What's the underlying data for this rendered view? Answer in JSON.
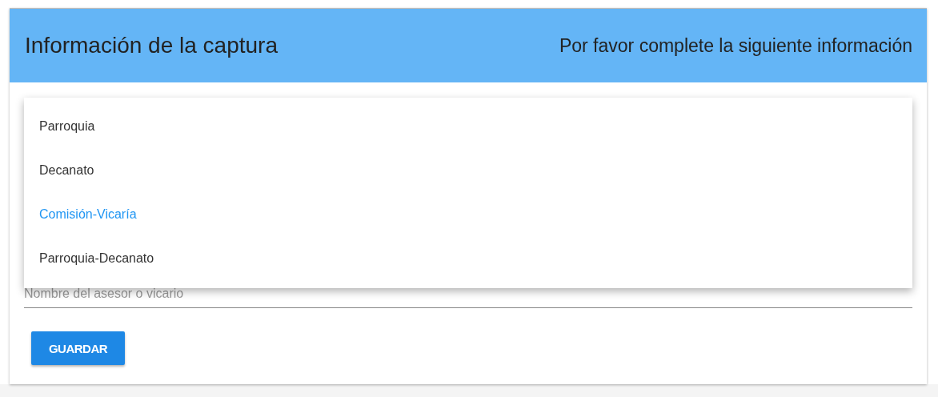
{
  "header": {
    "title": "Información de la captura",
    "subtitle": "Por favor complete la siguiente información"
  },
  "menu": {
    "items": [
      {
        "label": "Parroquia",
        "selected": false
      },
      {
        "label": "Decanato",
        "selected": false
      },
      {
        "label": "Comisión-Vicaría",
        "selected": true
      },
      {
        "label": "Parroquia-Decanato",
        "selected": false
      }
    ]
  },
  "field": {
    "placeholder": "Nombre del asesor o vicario"
  },
  "save_button": "GUARDAR"
}
